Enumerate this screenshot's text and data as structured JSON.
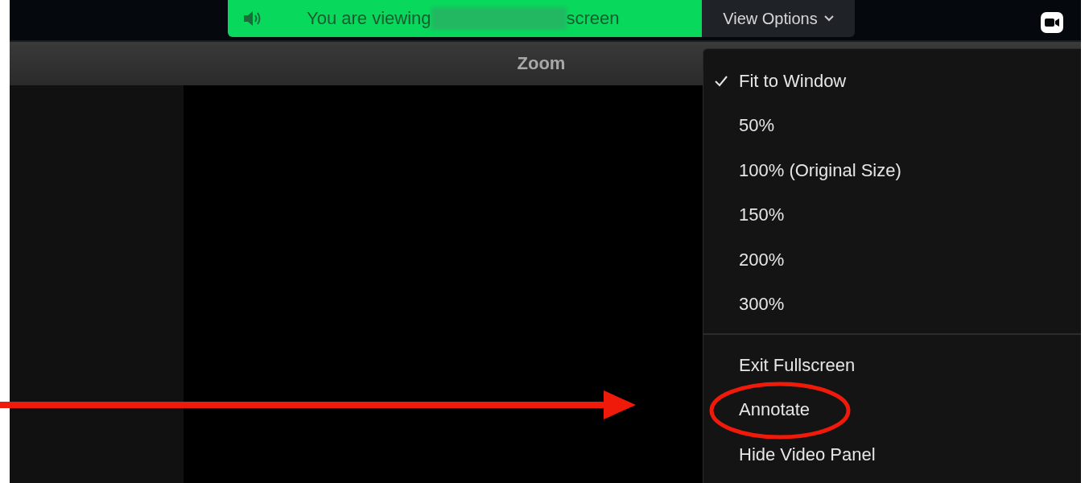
{
  "share_banner": {
    "prefix": "You are viewing",
    "suffix": "screen",
    "name_redacted": true
  },
  "view_options": {
    "label": "View Options",
    "expanded": true
  },
  "window": {
    "title": "Zoom"
  },
  "menu": {
    "groups": [
      [
        {
          "label": "Fit to Window",
          "checked": true,
          "circled": false
        },
        {
          "label": "50%",
          "checked": false,
          "circled": false
        },
        {
          "label": "100% (Original Size)",
          "checked": false,
          "circled": false
        },
        {
          "label": "150%",
          "checked": false,
          "circled": false
        },
        {
          "label": "200%",
          "checked": false,
          "circled": false
        },
        {
          "label": "300%",
          "checked": false,
          "circled": false
        }
      ],
      [
        {
          "label": "Exit Fullscreen",
          "checked": false,
          "circled": false
        },
        {
          "label": "Annotate",
          "checked": false,
          "circled": true
        },
        {
          "label": "Hide Video Panel",
          "checked": false,
          "circled": false
        }
      ]
    ]
  },
  "pointer_arrow": true
}
